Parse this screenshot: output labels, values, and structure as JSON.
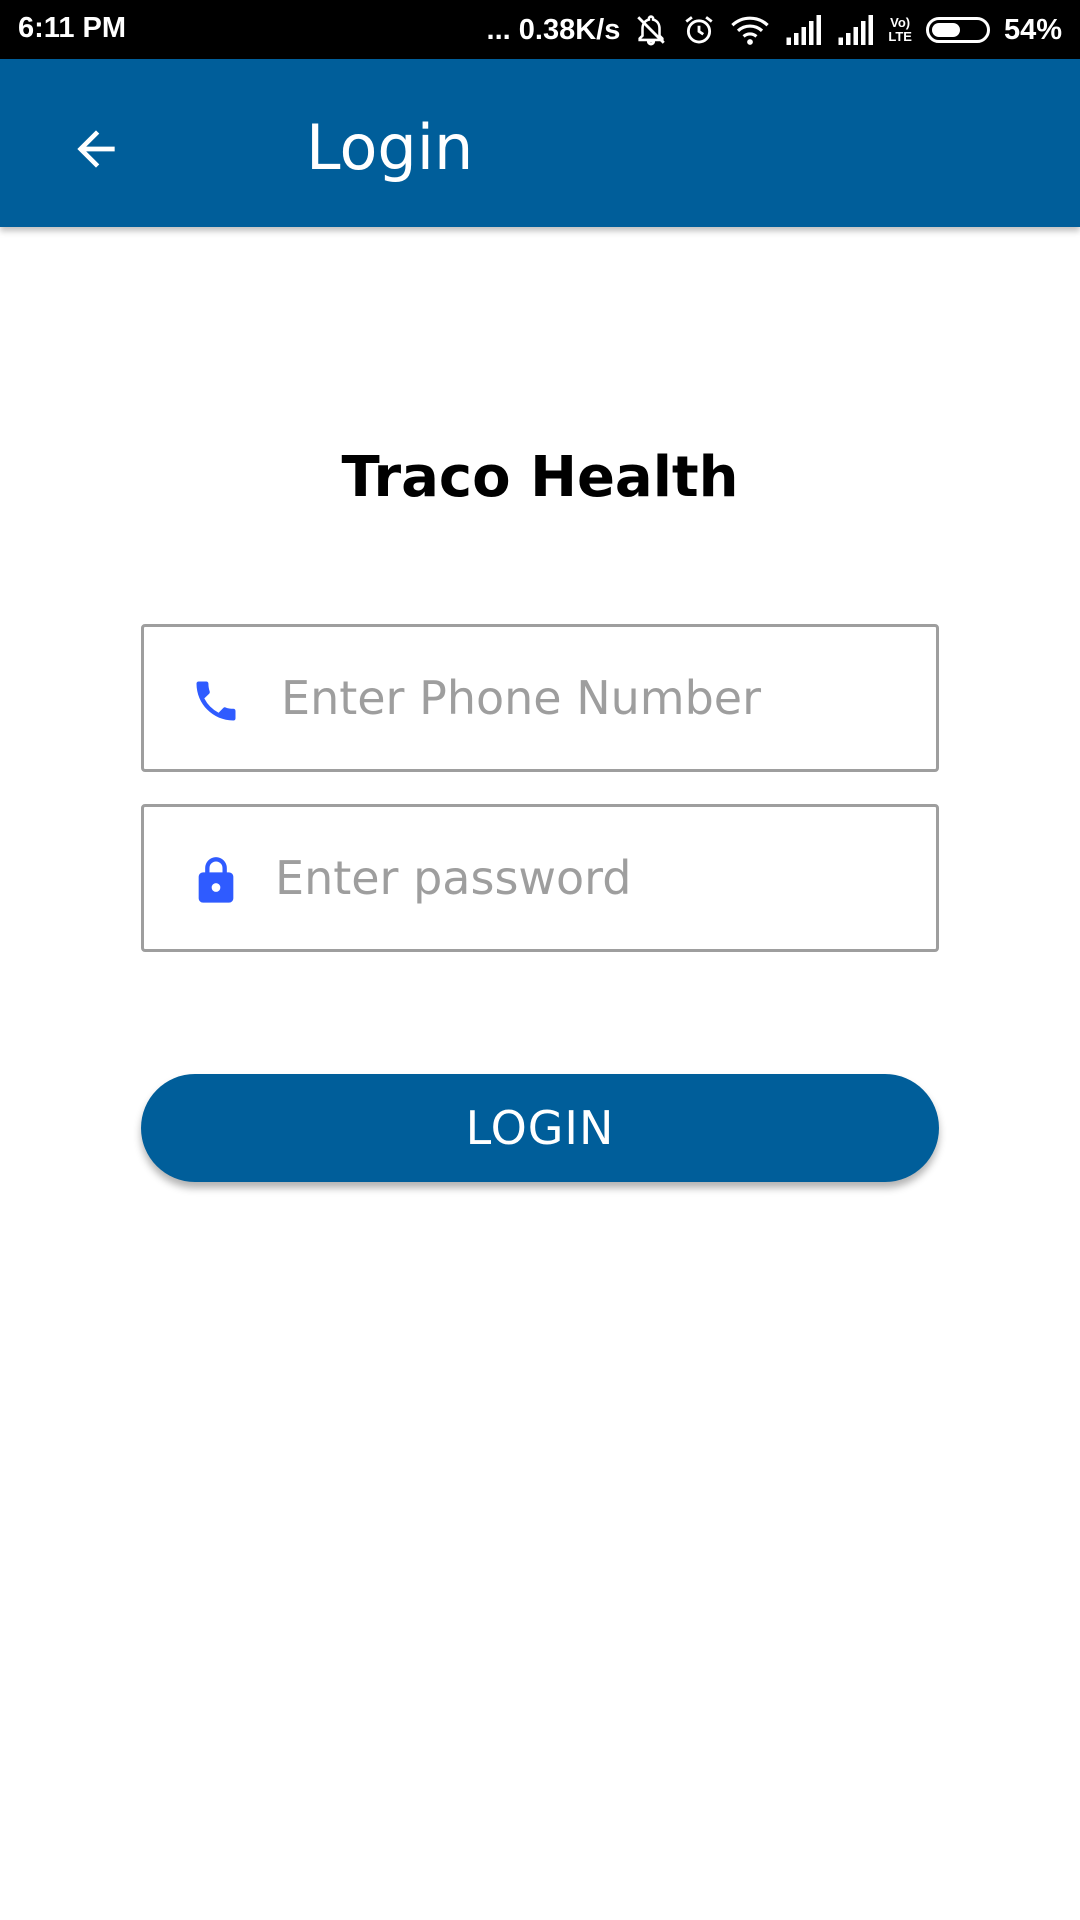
{
  "status_bar": {
    "time": "6:11 PM",
    "network_speed": "... 0.38K/s",
    "lte_label_top": "Vo)",
    "lte_label_bottom": "LTE",
    "battery_percent": "54%",
    "battery_level": 0.54,
    "icons": [
      "mute-icon",
      "alarm-icon",
      "wifi-icon",
      "signal-icon",
      "signal-icon",
      "volte-icon",
      "battery-icon"
    ]
  },
  "app_bar": {
    "title": "Login",
    "back_icon": "arrow-back-icon",
    "color": "#005e9a"
  },
  "brand": {
    "title": "Traco Health"
  },
  "form": {
    "phone": {
      "icon": "phone-icon",
      "placeholder": "Enter Phone Number",
      "value": ""
    },
    "password": {
      "icon": "lock-icon",
      "placeholder": "Enter password",
      "value": ""
    },
    "icon_color": "#2f5bff"
  },
  "login_button": {
    "label": "LOGIN",
    "color": "#005e9a"
  }
}
